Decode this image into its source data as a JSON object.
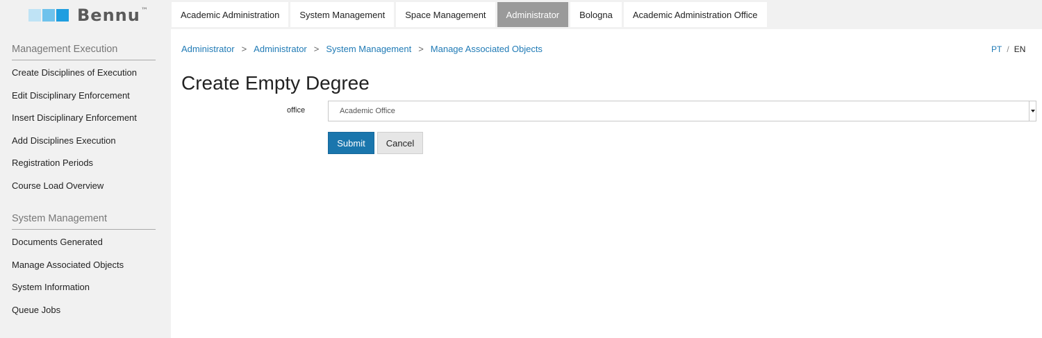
{
  "brand": {
    "name": "Bennu",
    "trademark": "™",
    "colors": [
      "#bfe3f5",
      "#6fc2ec",
      "#1f9ee0"
    ]
  },
  "nav": {
    "tabs": [
      {
        "label": "Academic Administration",
        "active": false
      },
      {
        "label": "System Management",
        "active": false
      },
      {
        "label": "Space Management",
        "active": false
      },
      {
        "label": "Administrator",
        "active": true
      },
      {
        "label": "Bologna",
        "active": false
      },
      {
        "label": "Academic Administration Office",
        "active": false
      }
    ]
  },
  "sidebar": {
    "sections": [
      {
        "heading": "Management Execution",
        "items": [
          "Create Disciplines of Execution",
          "Edit Disciplinary Enforcement",
          "Insert Disciplinary Enforcement",
          "Add Disciplines Execution",
          "Registration Periods",
          "Course Load Overview"
        ]
      },
      {
        "heading": "System Management",
        "items": [
          "Documents Generated",
          "Manage Associated Objects",
          "System Information",
          "Queue Jobs"
        ]
      }
    ]
  },
  "breadcrumb": {
    "items": [
      "Administrator",
      "Administrator",
      "System Management",
      "Manage Associated Objects"
    ],
    "separator": ">"
  },
  "language": {
    "pt": "PT",
    "separator": "/",
    "en": "EN",
    "active": "EN"
  },
  "page": {
    "title": "Create Empty Degree"
  },
  "form": {
    "office_label": "office",
    "office_value": "Academic Office",
    "submit_label": "Submit",
    "cancel_label": "Cancel"
  },
  "colors": {
    "link": "#1f7ab5",
    "primary_button": "#1a76ad",
    "active_tab": "#9a9a9a",
    "sidebar_bg": "#f1f1f1"
  }
}
